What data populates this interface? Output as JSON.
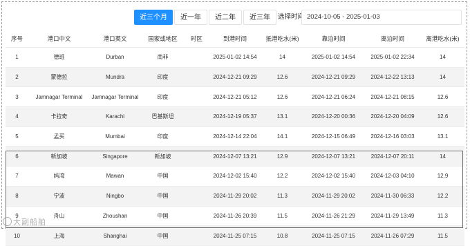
{
  "tabs": [
    {
      "label": "近三个月",
      "active": true
    },
    {
      "label": "近一年",
      "active": false
    },
    {
      "label": "近二年",
      "active": false
    },
    {
      "label": "近三年",
      "active": false
    }
  ],
  "range": {
    "label": "选择时间",
    "value": "2024-10-05 - 2025-01-03"
  },
  "columns": [
    "序号",
    "港口中文",
    "港口英文",
    "国家或地区",
    "时区",
    "到港时间",
    "抵港吃水(米)",
    "靠泊时间",
    "离泊时间",
    "离港吃水(米)"
  ],
  "rows": [
    [
      "1",
      "德班",
      "Durban",
      "南非",
      "",
      "2025-01-02 14:54",
      "14",
      "2025-01-02 14:54",
      "2025-01-02 22:34",
      "14"
    ],
    [
      "2",
      "蒙德拉",
      "Mundra",
      "印度",
      "",
      "2024-12-21 09:29",
      "12.6",
      "2024-12-21 09:29",
      "2024-12-22 13:13",
      "14"
    ],
    [
      "3",
      "Jamnagar Terminal",
      "Jamnagar Terminal",
      "印度",
      "",
      "2024-12-21 05:12",
      "12.6",
      "2024-12-21 06:24",
      "2024-12-21 08:15",
      "12.6"
    ],
    [
      "4",
      "卡拉奇",
      "Karachi",
      "巴基斯坦",
      "",
      "2024-12-19 05:37",
      "13.1",
      "2024-12-20 00:36",
      "2024-12-20 04:09",
      "12.6"
    ],
    [
      "5",
      "孟买",
      "Mumbai",
      "印度",
      "",
      "2024-12-14 22:04",
      "14.1",
      "2024-12-15 06:49",
      "2024-12-16 03:03",
      "13.1"
    ],
    [
      "6",
      "新加坡",
      "Singapore",
      "新加坡",
      "",
      "2024-12-07 13:21",
      "12.9",
      "2024-12-07 13:21",
      "2024-12-07 20:11",
      "14"
    ],
    [
      "7",
      "妈湾",
      "Mawan",
      "中国",
      "",
      "2024-12-02 15:40",
      "12.2",
      "2024-12-02 15:40",
      "2024-12-03 04:10",
      "12.9"
    ],
    [
      "8",
      "宁波",
      "Ningbo",
      "中国",
      "",
      "2024-11-29 20:02",
      "11.3",
      "2024-11-29 20:02",
      "2024-11-30 06:33",
      "12.2"
    ],
    [
      "9",
      "舟山",
      "Zhoushan",
      "中国",
      "",
      "2024-11-26 20:39",
      "11.5",
      "2024-11-26 21:29",
      "2024-11-29 13:49",
      "11.3"
    ],
    [
      "10",
      "上海",
      "Shanghai",
      "中国",
      "",
      "2024-11-25 07:15",
      "10.8",
      "2024-11-25 07:15",
      "2024-11-26 07:29",
      "11.5"
    ]
  ],
  "watermark": "大副船舶",
  "colors": {
    "accent": "#1e90ff",
    "stripe": "#f3f3f3",
    "highlight_border": "#6c6c6c"
  }
}
